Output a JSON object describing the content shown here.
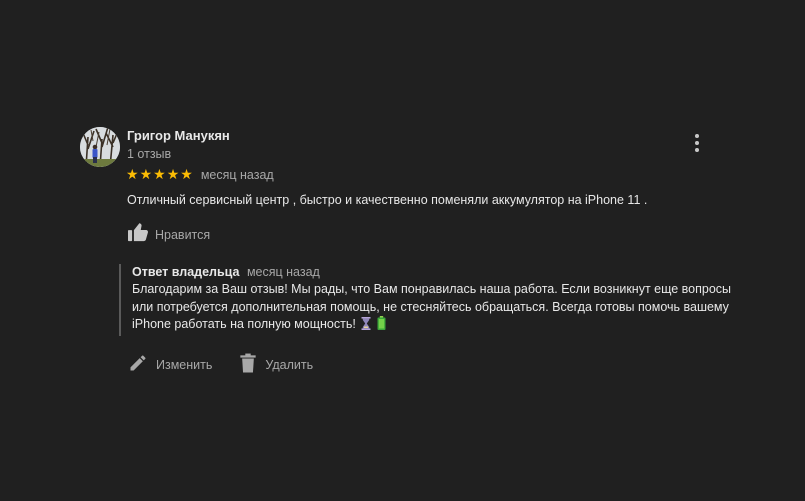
{
  "review": {
    "author": "Григор Манукян",
    "review_count": "1 отзыв",
    "rating": 5,
    "max_rating": 5,
    "date": "месяц назад",
    "text": "Отличный сервисный центр , быстро и качественно поменяли аккумулятор на iPhone 11 .",
    "like_label": "Нравится"
  },
  "owner_reply": {
    "title": "Ответ владельца",
    "date": "месяц назад",
    "text": "Благодарим за Ваш отзыв! Мы рады, что Вам понравилась наша работа. Если возникнут еще вопросы или потребуется дополнительная помощь, не стесняйтесь обращаться. Всегда готовы помочь вашему iPhone работать на полную мощность!"
  },
  "actions": {
    "edit_label": "Изменить",
    "delete_label": "Удалить"
  },
  "icons": {
    "more": "more-vert-icon",
    "like": "thumb-up-icon",
    "edit": "pencil-icon",
    "delete": "trash-icon",
    "star": "star-icon"
  },
  "colors": {
    "background": "#202020",
    "star": "#fbbc04",
    "text_primary": "#e8e8e8",
    "text_secondary": "#a8a8a8"
  }
}
